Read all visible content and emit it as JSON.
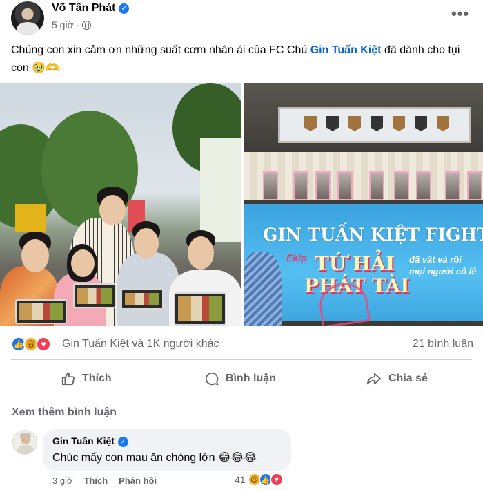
{
  "post": {
    "author": "Võ Tấn Phát",
    "time": "5 giờ",
    "separator": "·",
    "more_label": "•••",
    "caption_before": "Chúng con xin cảm ơn những suất cơm nhân ái của FC Chú ",
    "caption_tag": "Gin Tuấn Kiệt",
    "caption_after": " đã dành cho tụi con 🥹🫶"
  },
  "photo_right": {
    "banner_title": "GIN TUẤN KIỆT FIGHTI",
    "banner_ekip": "Ekip",
    "banner_line1": "TỨ HẢI",
    "banner_line2": "PHÁT TÀI",
    "banner_note_1": "đã vất vả rồi",
    "banner_note_2": "mọi người cố lê"
  },
  "stats": {
    "reactions_text": "Gin Tuấn Kiệt và 1K người khác",
    "comments_text": "21 bình luận",
    "reaction_icons": [
      "like-reaction",
      "haha-reaction",
      "love-reaction"
    ]
  },
  "actions": {
    "like": "Thích",
    "comment": "Bình luận",
    "share": "Chia sẻ"
  },
  "comments": {
    "see_more": "Xem thêm bình luận",
    "items": [
      {
        "author": "Gin Tuấn Kiệt",
        "text": "Chúc mấy con mau ăn chóng lớn 😂😂😂",
        "time": "3 giờ",
        "like_label": "Thích",
        "reply_label": "Phản hồi",
        "reaction_count": "41"
      }
    ]
  },
  "colors": {
    "link": "#0064d1",
    "secondary_text": "#65676b",
    "like_blue": "#1877f2",
    "love_red": "#f33e58",
    "haha_yellow": "#f7b125"
  }
}
